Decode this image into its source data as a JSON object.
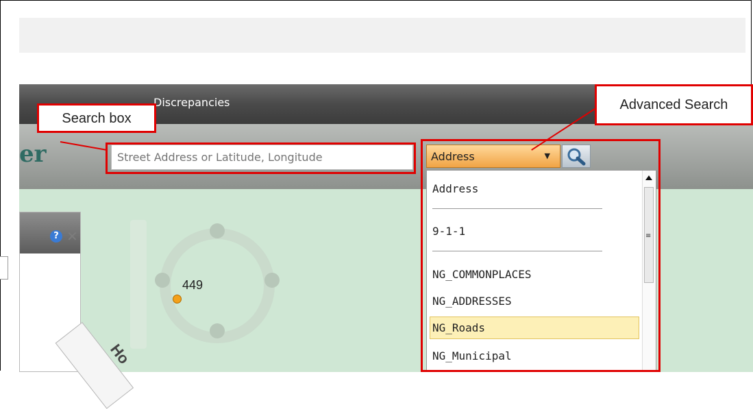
{
  "menu": {
    "discrepancies": "Discrepancies"
  },
  "logo": {
    "fragment": "er"
  },
  "search": {
    "placeholder": "Street Address or Latitude, Longitude"
  },
  "search_type": {
    "selected": "Address"
  },
  "dropdown": {
    "items": [
      "Address",
      "9-1-1",
      "NG_COMMONPLACES",
      "NG_ADDRESSES",
      "NG_Roads",
      "NG_Municipal"
    ],
    "highlighted": "NG_Roads"
  },
  "map": {
    "label": "449",
    "road_label": "Ho"
  },
  "panel": {
    "help": "?"
  },
  "annotations": {
    "search_box": "Search box",
    "advanced_search": "Advanced Search"
  },
  "colors": {
    "highlight_red": "#e00000",
    "map_green": "#cfe7d4",
    "dropdown_orange": "#f1a445",
    "selection_yellow": "#fdf0b7"
  }
}
